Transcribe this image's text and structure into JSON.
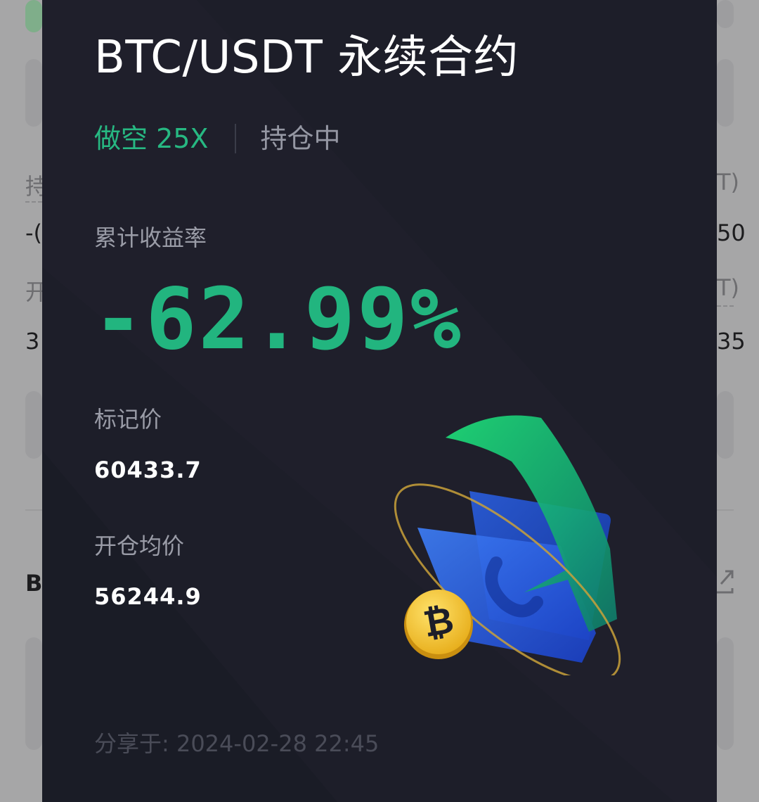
{
  "background_page": {
    "fragments_left": [
      "持",
      "-(",
      "开",
      "3"
    ],
    "fragments_right": [
      "T)",
      "50",
      "T)",
      "35"
    ],
    "section_letter": "B"
  },
  "card": {
    "title": "BTC/USDT 永续合约",
    "side": "做空 25X",
    "status": "持仓中",
    "pnl_label": "累计收益率",
    "pnl_value": "-62.99%",
    "mark_price_label": "标记价",
    "mark_price": "60433.7",
    "entry_price_label": "开仓均价",
    "entry_price": "56244.9",
    "shared_at": "分享于: 2024-02-28 22:45"
  },
  "illustration": {
    "icons": [
      "bitcoin-coin-icon",
      "wallet-icon",
      "down-arrow-icon"
    ]
  },
  "colors": {
    "card_bg": "#1d1e29",
    "accent_green": "#22b57f",
    "text_primary": "#ffffff",
    "text_secondary": "#9a9ca7",
    "text_muted": "#4a4c58",
    "coin_gold": "#f4c531"
  }
}
